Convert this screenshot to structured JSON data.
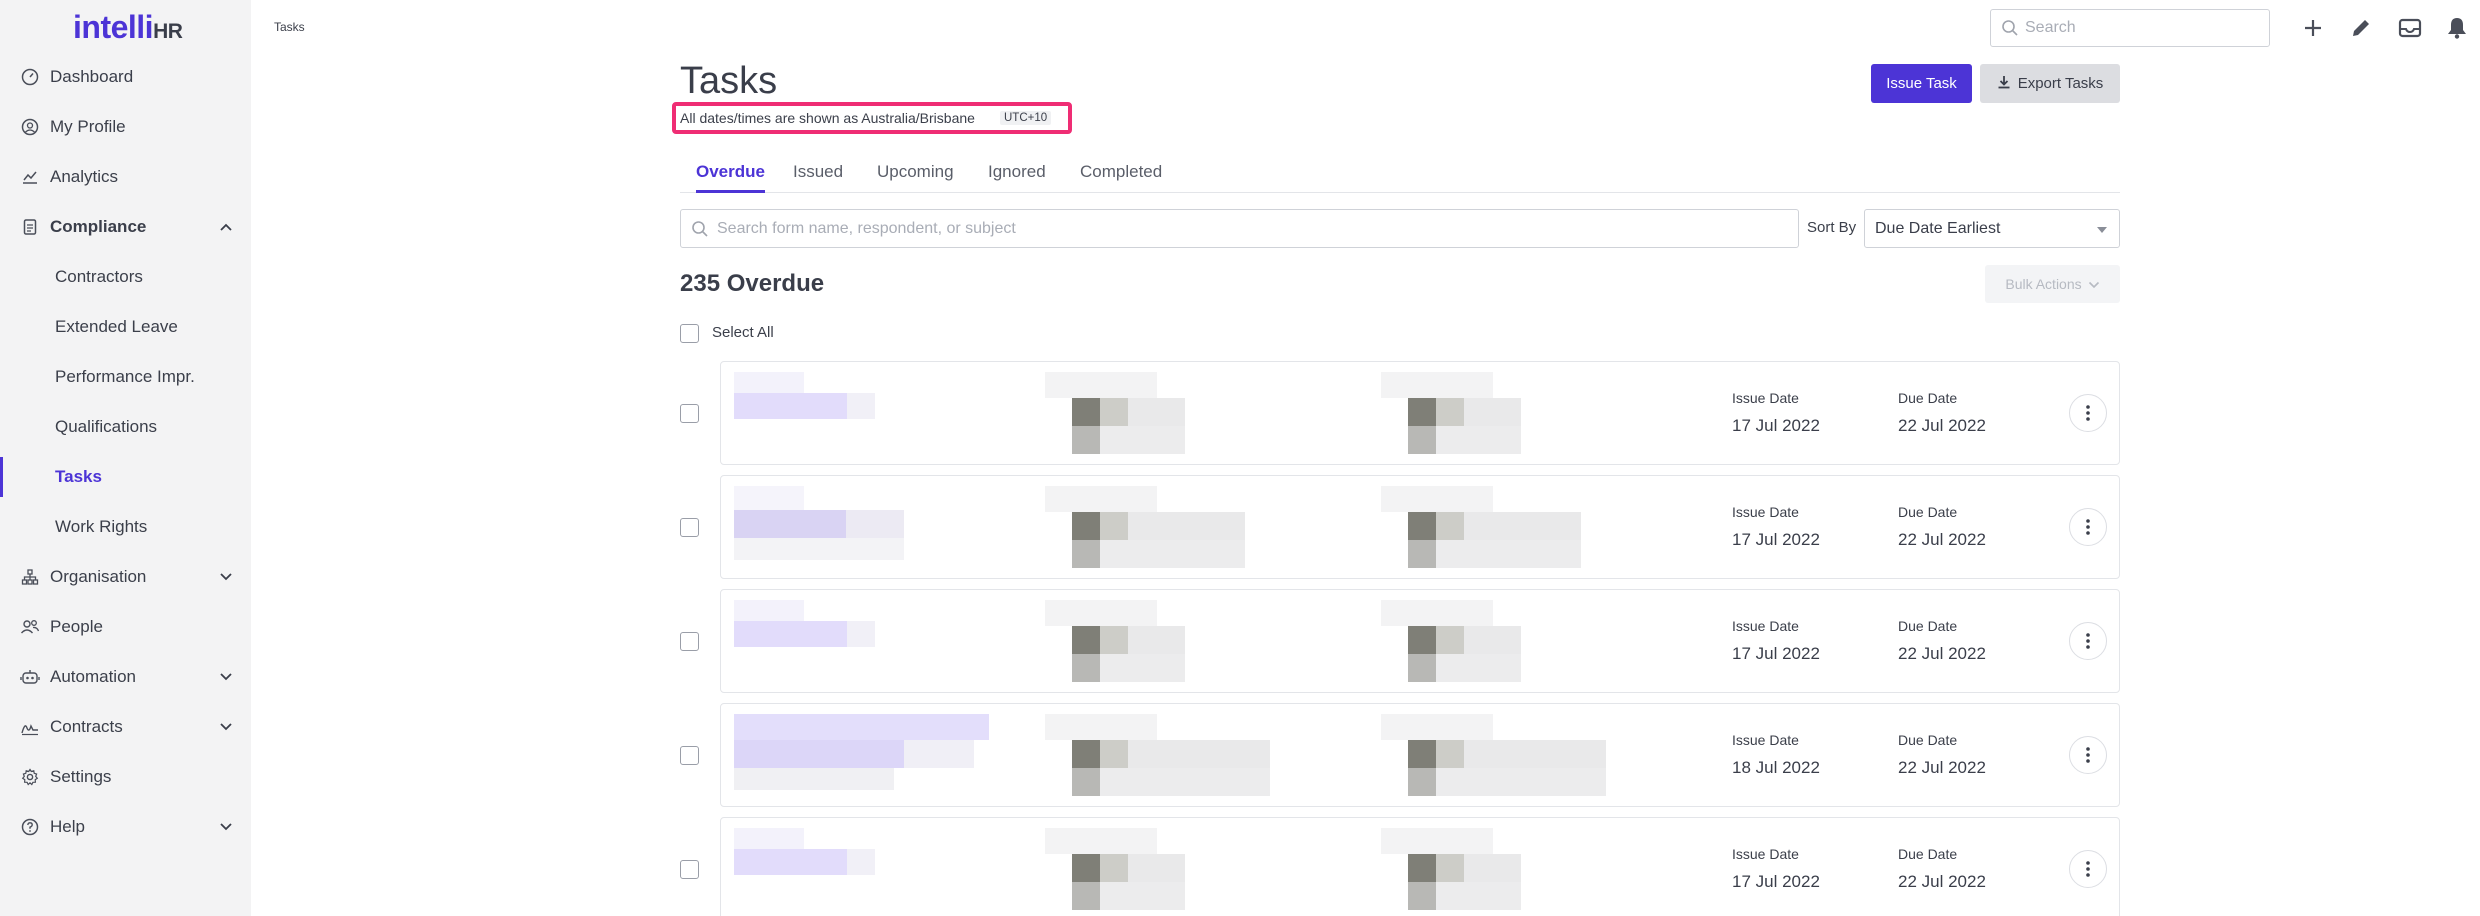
{
  "brand": {
    "name": "intelli",
    "suffix": "HR",
    "color": "#4c34d6"
  },
  "breadcrumb": "Tasks",
  "sidebar": {
    "items": [
      {
        "label": "Dashboard",
        "icon": "dashboard-icon"
      },
      {
        "label": "My Profile",
        "icon": "profile-icon"
      },
      {
        "label": "Analytics",
        "icon": "analytics-icon"
      },
      {
        "label": "Compliance",
        "icon": "compliance-icon",
        "expanded": true
      },
      {
        "label": "Contractors"
      },
      {
        "label": "Extended Leave"
      },
      {
        "label": "Performance Impr."
      },
      {
        "label": "Qualifications"
      },
      {
        "label": "Tasks",
        "active": true
      },
      {
        "label": "Work Rights"
      },
      {
        "label": "Organisation",
        "icon": "organisation-icon"
      },
      {
        "label": "People",
        "icon": "people-icon"
      },
      {
        "label": "Automation",
        "icon": "automation-icon"
      },
      {
        "label": "Contracts",
        "icon": "contracts-icon"
      },
      {
        "label": "Settings",
        "icon": "settings-icon"
      },
      {
        "label": "Help",
        "icon": "help-icon"
      }
    ]
  },
  "topbar": {
    "search_placeholder": "Search"
  },
  "page": {
    "title": "Tasks",
    "timezone_note": "All dates/times are shown as Australia/Brisbane",
    "timezone_badge": "UTC+10",
    "issue_task_label": "Issue Task",
    "export_tasks_label": "Export Tasks"
  },
  "tabs": [
    {
      "label": "Overdue",
      "active": true
    },
    {
      "label": "Issued"
    },
    {
      "label": "Upcoming"
    },
    {
      "label": "Ignored"
    },
    {
      "label": "Completed"
    }
  ],
  "filters": {
    "search_placeholder": "Search form name, respondent, or subject",
    "sort_label": "Sort By",
    "sort_value": "Due Date Earliest"
  },
  "list": {
    "count_title": "235 Overdue",
    "bulk_actions_label": "Bulk Actions",
    "select_all_label": "Select All",
    "issue_date_label": "Issue Date",
    "due_date_label": "Due Date",
    "rows": [
      {
        "issue_date": "17 Jul 2022",
        "due_date": "22 Jul 2022"
      },
      {
        "issue_date": "17 Jul 2022",
        "due_date": "22 Jul 2022"
      },
      {
        "issue_date": "17 Jul 2022",
        "due_date": "22 Jul 2022"
      },
      {
        "issue_date": "18 Jul 2022",
        "due_date": "22 Jul 2022"
      },
      {
        "issue_date": "17 Jul 2022",
        "due_date": "22 Jul 2022"
      }
    ]
  },
  "colors": {
    "accent": "#4c34d6",
    "highlight": "#ef2d74"
  }
}
